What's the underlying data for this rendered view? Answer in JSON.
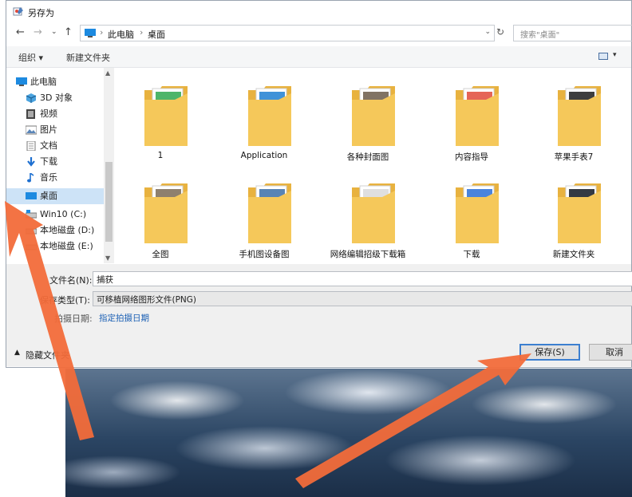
{
  "window": {
    "title": "另存为"
  },
  "address": {
    "crumbs": [
      "此电脑",
      "桌面"
    ],
    "search_placeholder": "搜索\"桌面\""
  },
  "toolbar": {
    "organize": "组织 ▾",
    "new_folder": "新建文件夹"
  },
  "nav": {
    "items": [
      {
        "label": "此电脑",
        "icon": "computer-icon"
      },
      {
        "label": "3D 对象",
        "icon": "cube-icon"
      },
      {
        "label": "视频",
        "icon": "video-icon"
      },
      {
        "label": "图片",
        "icon": "picture-icon"
      },
      {
        "label": "文档",
        "icon": "document-icon"
      },
      {
        "label": "下载",
        "icon": "download-arrow-icon"
      },
      {
        "label": "音乐",
        "icon": "music-note-icon"
      },
      {
        "label": "桌面",
        "icon": "desktop-icon"
      },
      {
        "label": "Win10 (C:)",
        "icon": "drive-icon"
      },
      {
        "label": "本地磁盘 (D:)",
        "icon": "drive-icon"
      },
      {
        "label": "本地磁盘 (E:)",
        "icon": "drive-icon"
      }
    ]
  },
  "folders": [
    {
      "label": "1",
      "accent": "#2fa84f"
    },
    {
      "label": "Application",
      "accent": "#1e7fd1"
    },
    {
      "label": "各种封面图",
      "accent": "#6b5a49"
    },
    {
      "label": "内容指导",
      "accent": "#e04a3a"
    },
    {
      "label": "苹果手表7",
      "accent": "#1c1c1c"
    },
    {
      "label": "全图",
      "accent": "#7a6a55"
    },
    {
      "label": "手机图设备图",
      "accent": "#3b6ea8"
    },
    {
      "label": "网络编辑招级下载箱",
      "accent": "#d9d9d9"
    },
    {
      "label": "下载",
      "accent": "#2a6fd6"
    },
    {
      "label": "新建文件夹",
      "accent": "#0f1722"
    }
  ],
  "form": {
    "filename_label": "文件名(N):",
    "filename_value": "捕获",
    "filetype_label": "保存类型(T):",
    "filetype_value": "可移植网络图形文件(PNG)",
    "date_label": "拍摄日期:",
    "date_link": "指定拍摄日期",
    "hide_folders": "隐藏文件夹",
    "save_button": "保存(S)",
    "cancel_button": "取消"
  },
  "colors": {
    "accent": "#1a5fb4",
    "annotation_arrow": "#f26b3a",
    "folder": "#f5c85a"
  }
}
